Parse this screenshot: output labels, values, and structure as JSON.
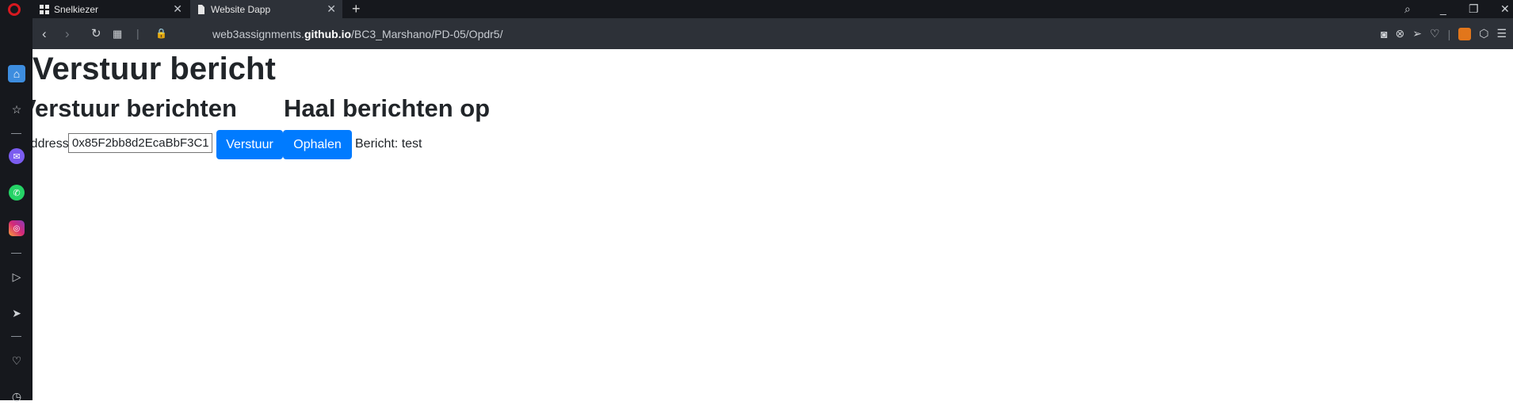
{
  "browser": {
    "tabs": [
      {
        "label": "Snelkiezer",
        "icon": "grid-icon",
        "active": false
      },
      {
        "label": "Website Dapp",
        "icon": "document-icon",
        "active": true
      }
    ],
    "url_host": "web3assignments.",
    "url_domain": "github.io",
    "url_path": "/BC3_Marshano/PD-05/Opdr5/",
    "accent_color": "#3d8ddf"
  },
  "page": {
    "title": "Verstuur bericht",
    "send_section_title": "Verstuur berichten",
    "get_section_title": "Haal berichten op",
    "address_label": "Address:",
    "address_value": "0x85F2bb8d2EcaBbF3C1",
    "send_button": "Verstuur",
    "get_button": "Ophalen",
    "message_label": "Bericht:",
    "message_value": "test",
    "button_color": "#007bff"
  }
}
